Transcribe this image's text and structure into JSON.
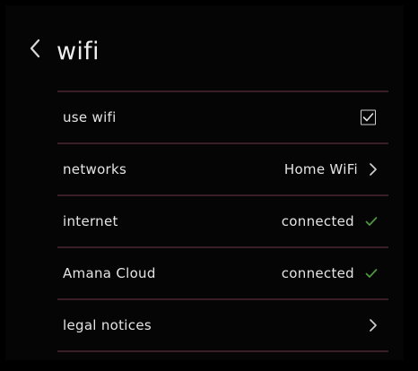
{
  "header": {
    "title": "wifi",
    "back_icon": "chevron-left-icon"
  },
  "rows": [
    {
      "label": "use wifi",
      "control": "checkbox",
      "checked": true
    },
    {
      "label": "networks",
      "value": "Home WiFi",
      "icon": "chevron-right-icon"
    },
    {
      "label": "internet",
      "value": "connected",
      "icon": "checkmark-icon"
    },
    {
      "label": "Amana Cloud",
      "value": "connected",
      "icon": "checkmark-icon"
    },
    {
      "label": "legal notices",
      "icon": "chevron-right-icon"
    }
  ],
  "colors": {
    "background": "#000000",
    "divider": "#3a1e26",
    "text": "#e4e4e4",
    "status_check": "#4f9a3f"
  }
}
